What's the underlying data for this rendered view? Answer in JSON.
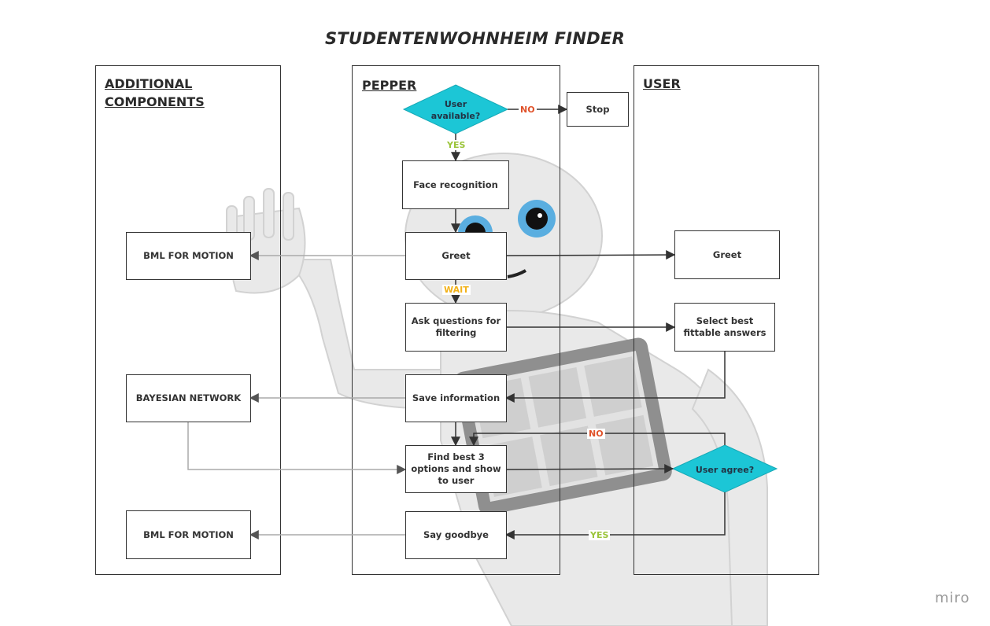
{
  "title": "STUDENTENWOHNHEIM FINDER",
  "lanes": {
    "additional": "ADDITIONAL COMPONENTS",
    "pepper": "PEPPER",
    "user": "USER"
  },
  "nodes": {
    "user_available": "User available?",
    "stop": "Stop",
    "face_recognition": "Face recognition",
    "greet_pepper": "Greet",
    "bml_motion_1": "BML FOR MOTION",
    "greet_user": "Greet",
    "ask_questions": "Ask questions for filtering",
    "select_answers": "Select best fittable answers",
    "bayesian_network": "BAYESIAN NETWORK",
    "save_information": "Save information",
    "find_best": "Find best 3 options and show to user",
    "user_agree": "User agree?",
    "say_goodbye": "Say goodbye",
    "bml_motion_2": "BML FOR MOTION"
  },
  "edge_labels": {
    "no_top": "NO",
    "yes_top": "YES",
    "wait": "WAIT",
    "no_agree": "NO",
    "yes_agree": "YES"
  },
  "colors": {
    "decision_fill": "#1cc6d6",
    "no": "#e0522a",
    "yes": "#9bc43a",
    "wait": "#f2b21a"
  },
  "watermark": "miro"
}
